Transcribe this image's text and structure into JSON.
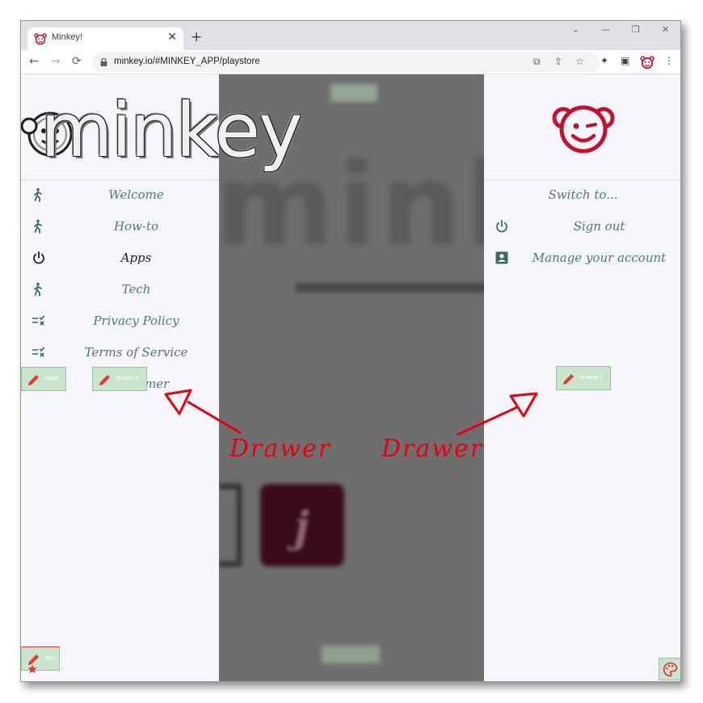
{
  "browser": {
    "tab_title": "Minkey!",
    "tab_close": "✕",
    "new_tab": "+",
    "url": "minkey.io/#MINKEY_APP/playstore",
    "window_controls": [
      "⌄",
      "—",
      "❐",
      "✕"
    ],
    "nav": {
      "back": "←",
      "forward": "→",
      "reload": "⟳"
    },
    "toolbar_icons": [
      "⧉",
      "⇪",
      "☆",
      "✦",
      "▣",
      "⋮"
    ]
  },
  "left_drawer": {
    "logo_text": "minkey",
    "items": [
      {
        "label": "Welcome",
        "icon": "person-walk-icon"
      },
      {
        "label": "How-to",
        "icon": "person-walk-icon"
      },
      {
        "label": "Apps",
        "icon": "power-icon",
        "active": true
      },
      {
        "label": "Tech",
        "icon": "person-walk-icon"
      },
      {
        "label": "Privacy Policy",
        "icon": "checklist-icon"
      },
      {
        "label": "Terms of Service",
        "icon": "checklist-icon"
      },
      {
        "label": "Disclaimer",
        "icon": "none"
      }
    ]
  },
  "right_drawer": {
    "heading": "Switch to...",
    "items": [
      {
        "label": "Sign out",
        "icon": "power-icon"
      },
      {
        "label": "Manage your account",
        "icon": "account-box-icon"
      }
    ]
  },
  "chips": {
    "page": "page",
    "drawer_left": "drawer1",
    "drawer_right": "drawer1",
    "app": "app"
  },
  "background": {
    "card_letter": "j"
  },
  "annotations": {
    "left": "Drawer",
    "right": "Drawer"
  },
  "colors": {
    "accent_red": "#c8102e",
    "drawer_text": "#4f7a6c",
    "chip_bg": "#c9e5cd",
    "annotation_red": "#e60012"
  }
}
